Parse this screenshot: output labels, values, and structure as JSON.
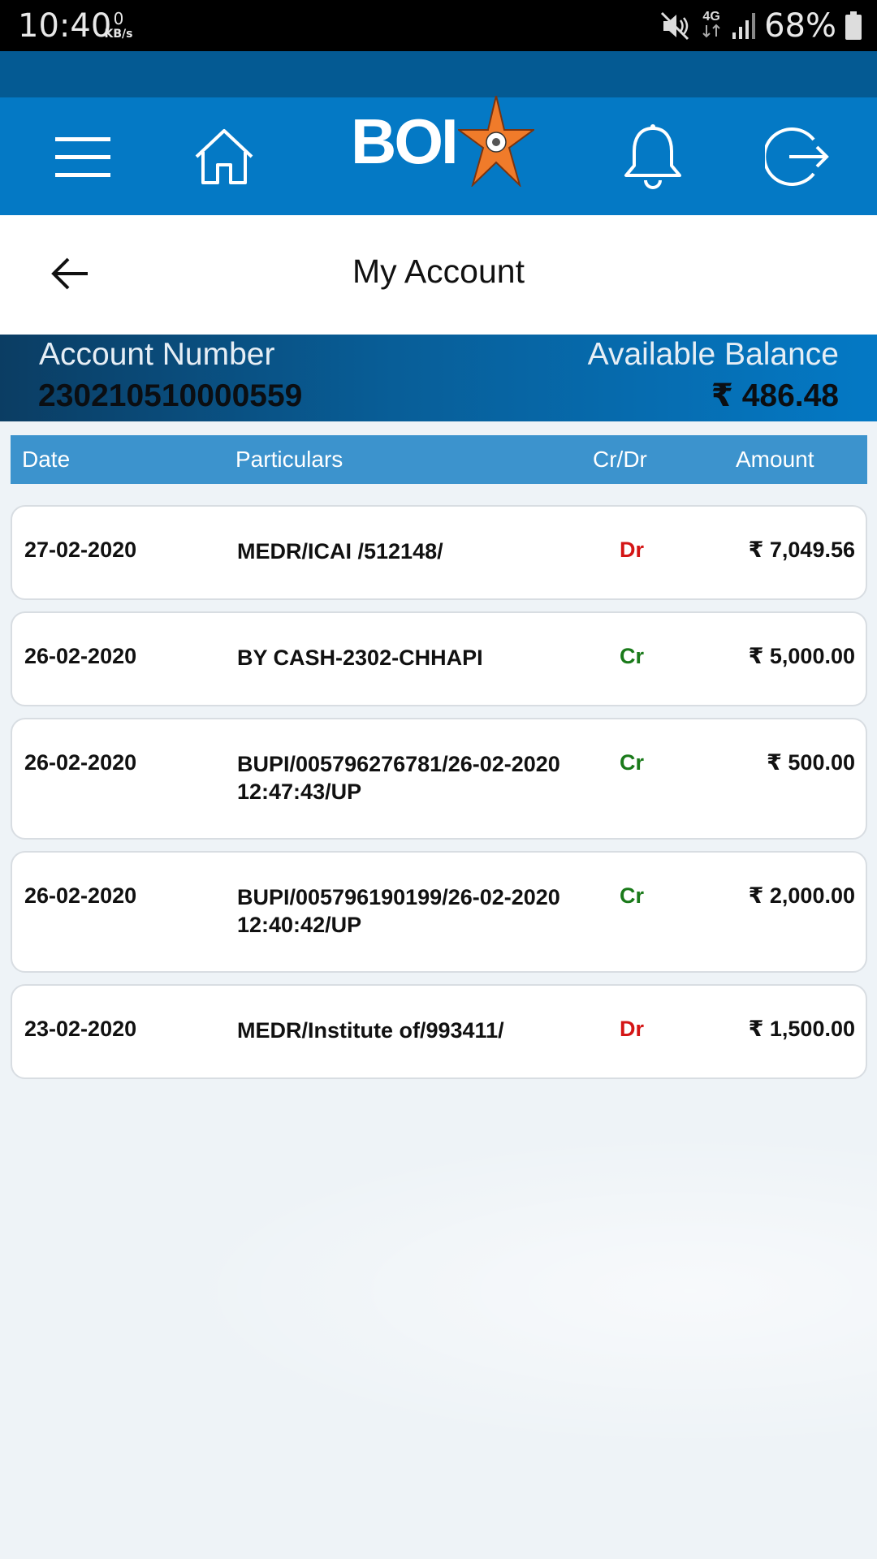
{
  "status_bar": {
    "time": "10:40",
    "net_speed_value": "0",
    "net_speed_unit": "KB/s",
    "network": "4G",
    "battery": "68%"
  },
  "header": {
    "logo_text": "BOI",
    "icons": [
      "menu-icon",
      "home-icon",
      "bell-icon",
      "logout-icon"
    ],
    "brand_color": "#0479c5"
  },
  "page": {
    "title": "My Account"
  },
  "account": {
    "number_label": "Account Number",
    "number": "230210510000559",
    "balance_label": "Available Balance",
    "balance": "₹ 486.48"
  },
  "table": {
    "headers": {
      "date": "Date",
      "particulars": "Particulars",
      "type": "Cr/Dr",
      "amount": "Amount"
    },
    "rows": [
      {
        "date": "27-02-2020",
        "particulars": "MEDR/ICAI /512148/",
        "type": "Dr",
        "amount": "₹ 7,049.56"
      },
      {
        "date": "26-02-2020",
        "particulars": "BY CASH-2302-CHHAPI",
        "type": "Cr",
        "amount": "₹ 5,000.00"
      },
      {
        "date": "26-02-2020",
        "particulars": "BUPI/005796276781/26-02-2020 12:47:43/UP",
        "type": "Cr",
        "amount": "₹ 500.00"
      },
      {
        "date": "26-02-2020",
        "particulars": "BUPI/005796190199/26-02-2020 12:40:42/UP",
        "type": "Cr",
        "amount": "₹ 2,000.00"
      },
      {
        "date": "23-02-2020",
        "particulars": "MEDR/Institute of/993411/",
        "type": "Dr",
        "amount": "₹ 1,500.00"
      }
    ]
  },
  "colors": {
    "credit": "#1a7a1a",
    "debit": "#d41515",
    "table_header": "#3c93cd"
  }
}
